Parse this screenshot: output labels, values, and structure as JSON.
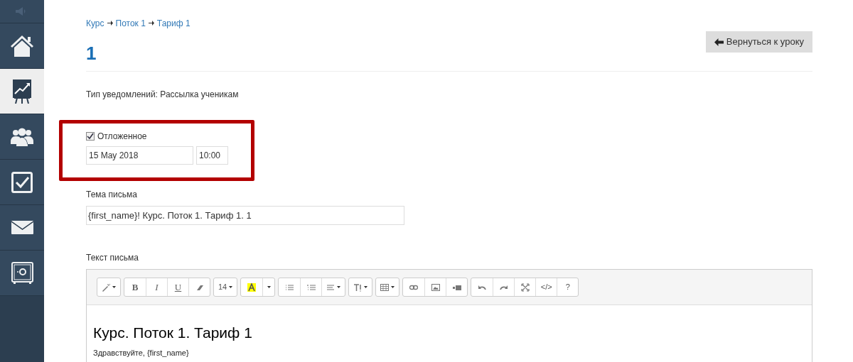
{
  "sidebar": {
    "items": [
      {
        "kind": "sound",
        "selected": false
      },
      {
        "kind": "home",
        "selected": false
      },
      {
        "kind": "chart",
        "selected": true
      },
      {
        "kind": "users",
        "selected": false
      },
      {
        "kind": "check",
        "selected": false
      },
      {
        "kind": "mail",
        "selected": false
      },
      {
        "kind": "safe",
        "selected": false
      }
    ]
  },
  "breadcrumbs": [
    "Курс",
    "Поток 1",
    "Тариф 1"
  ],
  "title": "1",
  "back_button": "Вернуться к уроку",
  "notification_type": "Тип уведомлений: Рассылка ученикам",
  "delayed": {
    "label": "Отложенное",
    "checked": true,
    "date": "15 May 2018",
    "time": "10:00"
  },
  "subject": {
    "label": "Тема письма",
    "value": "{first_name}! Курс. Поток 1. Тариф 1. 1"
  },
  "body": {
    "label": "Текст письма",
    "toolbar": [
      [
        {
          "kind": "icon_menu"
        }
      ],
      [
        {
          "kind": "text",
          "label": "B"
        },
        {
          "kind": "text",
          "label": "I"
        },
        {
          "kind": "text",
          "label": "U"
        },
        {
          "kind": "icon"
        }
      ],
      [
        {
          "kind": "text_menu",
          "label": "14"
        }
      ],
      [
        {
          "kind": "icon"
        },
        {
          "kind": "menu"
        }
      ],
      [
        {
          "kind": "icon"
        },
        {
          "kind": "icon"
        },
        {
          "kind": "icon_menu"
        }
      ],
      [
        {
          "kind": "icon_menu"
        }
      ],
      [
        {
          "kind": "icon_menu"
        }
      ],
      [
        {
          "kind": "icon"
        },
        {
          "kind": "icon"
        },
        {
          "kind": "icon"
        }
      ],
      [
        {
          "kind": "icon"
        },
        {
          "kind": "icon"
        },
        {
          "kind": "icon"
        },
        {
          "kind": "text",
          "label": "</>"
        },
        {
          "kind": "text",
          "label": "?"
        }
      ]
    ],
    "heading": "Курс. Поток 1. Тариф 1",
    "greeting": "Здравствуйте, {first_name}"
  }
}
